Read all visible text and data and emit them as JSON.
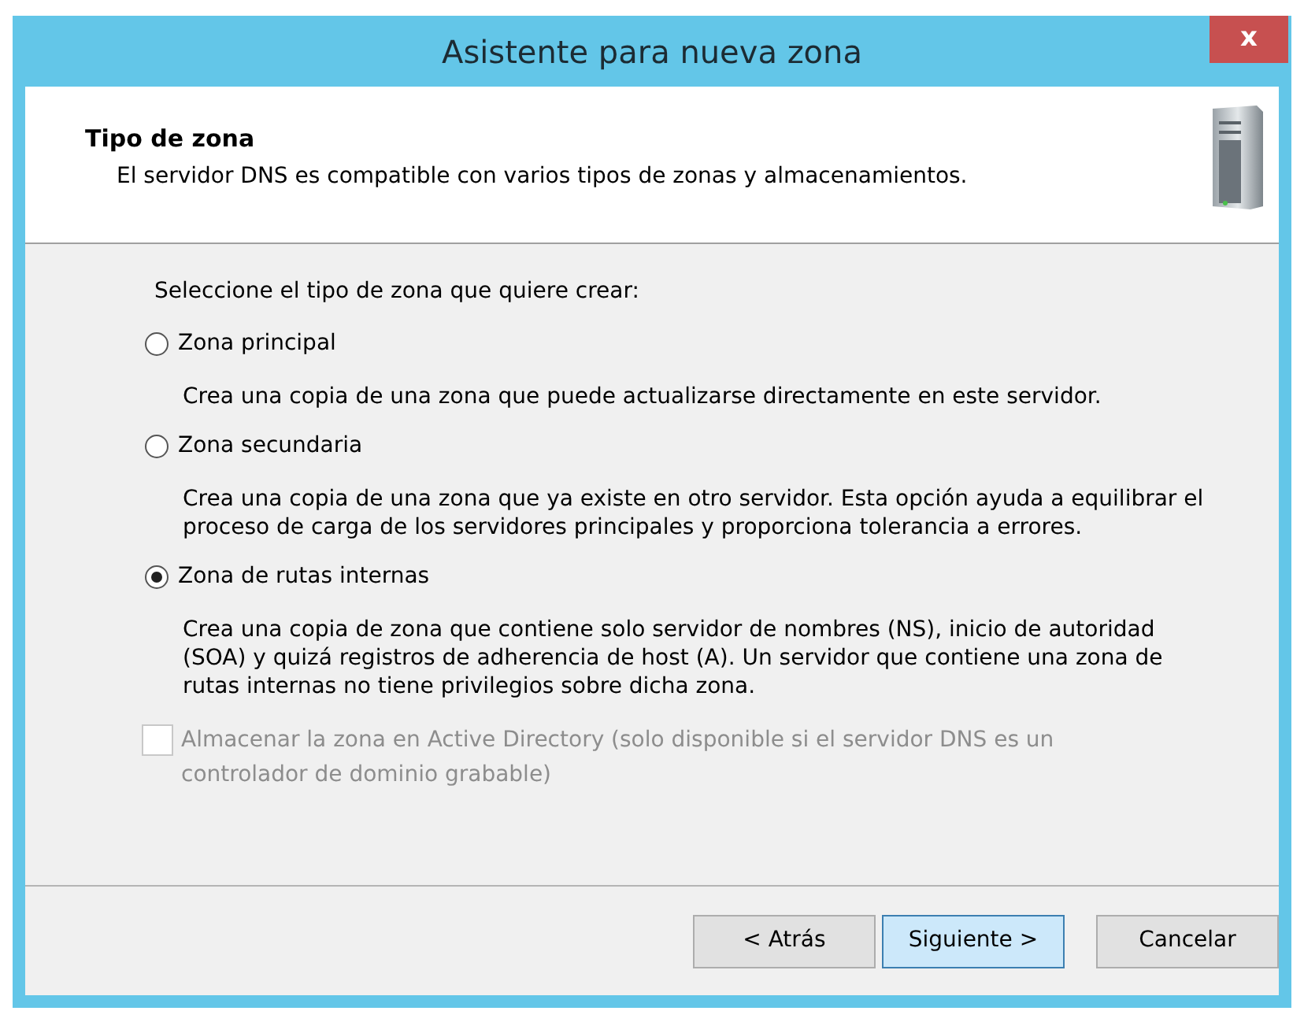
{
  "window": {
    "title": "Asistente para nueva zona",
    "close": "x"
  },
  "header": {
    "title": "Tipo de zona",
    "subtitle": "El servidor DNS es compatible con varios tipos de zonas y almacenamientos."
  },
  "prompt": "Seleccione el tipo de zona que quiere crear:",
  "options": [
    {
      "label": "Zona principal",
      "selected": false,
      "description": "Crea una copia de una zona que puede actualizarse directamente en este servidor."
    },
    {
      "label": "Zona secundaria",
      "selected": false,
      "description": "Crea una copia de una zona que ya existe en otro servidor. Esta opción ayuda a equilibrar el proceso de carga de los servidores principales y proporciona tolerancia a errores."
    },
    {
      "label": "Zona de rutas internas",
      "selected": true,
      "description": "Crea una copia de zona que contiene solo servidor de nombres (NS), inicio de autoridad (SOA) y quizá registros de adherencia de host (A). Un servidor que contiene una zona de rutas internas no tiene privilegios sobre dicha zona."
    }
  ],
  "store_in_ad": {
    "label": "Almacenar la zona en Active Directory (solo disponible si el servidor DNS es un controlador de dominio grabable)",
    "checked": false,
    "disabled": true
  },
  "buttons": [
    {
      "label": "< Atrás",
      "hovered": false
    },
    {
      "label": "Siguiente >",
      "hovered": true
    },
    {
      "label": "Cancelar",
      "hovered": false
    }
  ]
}
